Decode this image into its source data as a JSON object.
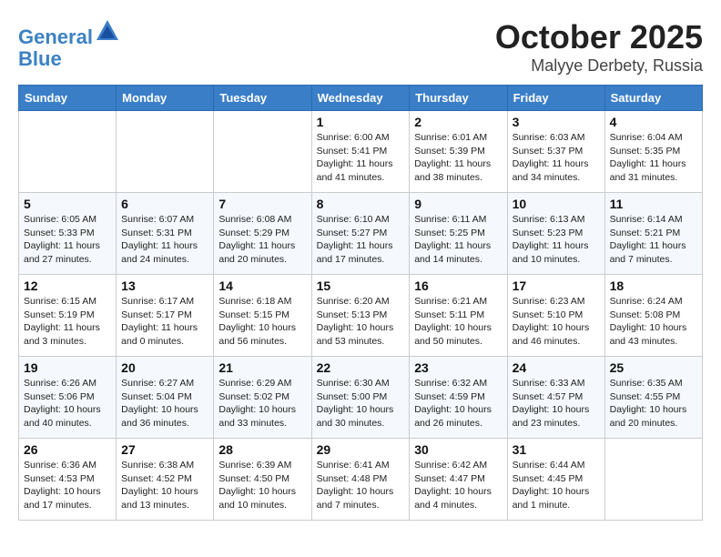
{
  "header": {
    "logo_line1": "General",
    "logo_line2": "Blue",
    "month": "October 2025",
    "location": "Malyye Derbety, Russia"
  },
  "weekdays": [
    "Sunday",
    "Monday",
    "Tuesday",
    "Wednesday",
    "Thursday",
    "Friday",
    "Saturday"
  ],
  "weeks": [
    [
      {
        "day": "",
        "info": ""
      },
      {
        "day": "",
        "info": ""
      },
      {
        "day": "",
        "info": ""
      },
      {
        "day": "1",
        "info": "Sunrise: 6:00 AM\nSunset: 5:41 PM\nDaylight: 11 hours\nand 41 minutes."
      },
      {
        "day": "2",
        "info": "Sunrise: 6:01 AM\nSunset: 5:39 PM\nDaylight: 11 hours\nand 38 minutes."
      },
      {
        "day": "3",
        "info": "Sunrise: 6:03 AM\nSunset: 5:37 PM\nDaylight: 11 hours\nand 34 minutes."
      },
      {
        "day": "4",
        "info": "Sunrise: 6:04 AM\nSunset: 5:35 PM\nDaylight: 11 hours\nand 31 minutes."
      }
    ],
    [
      {
        "day": "5",
        "info": "Sunrise: 6:05 AM\nSunset: 5:33 PM\nDaylight: 11 hours\nand 27 minutes."
      },
      {
        "day": "6",
        "info": "Sunrise: 6:07 AM\nSunset: 5:31 PM\nDaylight: 11 hours\nand 24 minutes."
      },
      {
        "day": "7",
        "info": "Sunrise: 6:08 AM\nSunset: 5:29 PM\nDaylight: 11 hours\nand 20 minutes."
      },
      {
        "day": "8",
        "info": "Sunrise: 6:10 AM\nSunset: 5:27 PM\nDaylight: 11 hours\nand 17 minutes."
      },
      {
        "day": "9",
        "info": "Sunrise: 6:11 AM\nSunset: 5:25 PM\nDaylight: 11 hours\nand 14 minutes."
      },
      {
        "day": "10",
        "info": "Sunrise: 6:13 AM\nSunset: 5:23 PM\nDaylight: 11 hours\nand 10 minutes."
      },
      {
        "day": "11",
        "info": "Sunrise: 6:14 AM\nSunset: 5:21 PM\nDaylight: 11 hours\nand 7 minutes."
      }
    ],
    [
      {
        "day": "12",
        "info": "Sunrise: 6:15 AM\nSunset: 5:19 PM\nDaylight: 11 hours\nand 3 minutes."
      },
      {
        "day": "13",
        "info": "Sunrise: 6:17 AM\nSunset: 5:17 PM\nDaylight: 11 hours\nand 0 minutes."
      },
      {
        "day": "14",
        "info": "Sunrise: 6:18 AM\nSunset: 5:15 PM\nDaylight: 10 hours\nand 56 minutes."
      },
      {
        "day": "15",
        "info": "Sunrise: 6:20 AM\nSunset: 5:13 PM\nDaylight: 10 hours\nand 53 minutes."
      },
      {
        "day": "16",
        "info": "Sunrise: 6:21 AM\nSunset: 5:11 PM\nDaylight: 10 hours\nand 50 minutes."
      },
      {
        "day": "17",
        "info": "Sunrise: 6:23 AM\nSunset: 5:10 PM\nDaylight: 10 hours\nand 46 minutes."
      },
      {
        "day": "18",
        "info": "Sunrise: 6:24 AM\nSunset: 5:08 PM\nDaylight: 10 hours\nand 43 minutes."
      }
    ],
    [
      {
        "day": "19",
        "info": "Sunrise: 6:26 AM\nSunset: 5:06 PM\nDaylight: 10 hours\nand 40 minutes."
      },
      {
        "day": "20",
        "info": "Sunrise: 6:27 AM\nSunset: 5:04 PM\nDaylight: 10 hours\nand 36 minutes."
      },
      {
        "day": "21",
        "info": "Sunrise: 6:29 AM\nSunset: 5:02 PM\nDaylight: 10 hours\nand 33 minutes."
      },
      {
        "day": "22",
        "info": "Sunrise: 6:30 AM\nSunset: 5:00 PM\nDaylight: 10 hours\nand 30 minutes."
      },
      {
        "day": "23",
        "info": "Sunrise: 6:32 AM\nSunset: 4:59 PM\nDaylight: 10 hours\nand 26 minutes."
      },
      {
        "day": "24",
        "info": "Sunrise: 6:33 AM\nSunset: 4:57 PM\nDaylight: 10 hours\nand 23 minutes."
      },
      {
        "day": "25",
        "info": "Sunrise: 6:35 AM\nSunset: 4:55 PM\nDaylight: 10 hours\nand 20 minutes."
      }
    ],
    [
      {
        "day": "26",
        "info": "Sunrise: 6:36 AM\nSunset: 4:53 PM\nDaylight: 10 hours\nand 17 minutes."
      },
      {
        "day": "27",
        "info": "Sunrise: 6:38 AM\nSunset: 4:52 PM\nDaylight: 10 hours\nand 13 minutes."
      },
      {
        "day": "28",
        "info": "Sunrise: 6:39 AM\nSunset: 4:50 PM\nDaylight: 10 hours\nand 10 minutes."
      },
      {
        "day": "29",
        "info": "Sunrise: 6:41 AM\nSunset: 4:48 PM\nDaylight: 10 hours\nand 7 minutes."
      },
      {
        "day": "30",
        "info": "Sunrise: 6:42 AM\nSunset: 4:47 PM\nDaylight: 10 hours\nand 4 minutes."
      },
      {
        "day": "31",
        "info": "Sunrise: 6:44 AM\nSunset: 4:45 PM\nDaylight: 10 hours\nand 1 minute."
      },
      {
        "day": "",
        "info": ""
      }
    ]
  ]
}
